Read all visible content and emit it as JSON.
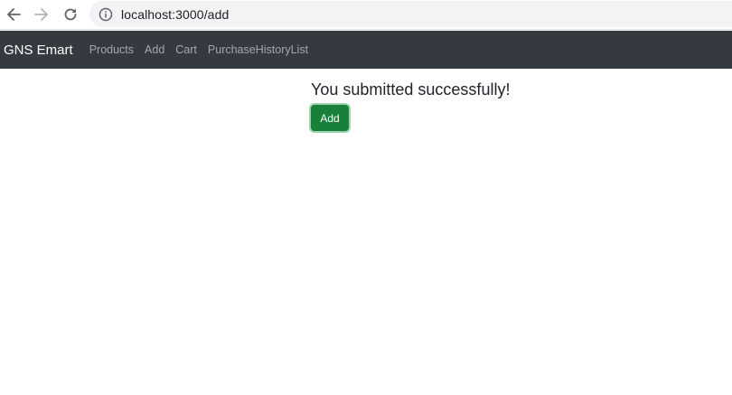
{
  "browser": {
    "url": "localhost:3000/add",
    "icons": {
      "back": "arrow-left-icon",
      "forward": "arrow-right-icon",
      "reload": "reload-icon",
      "info": "info-circle-icon"
    }
  },
  "navbar": {
    "brand": "GNS Emart",
    "links": [
      "Products",
      "Add",
      "Cart",
      "PurchaseHistoryList"
    ]
  },
  "main": {
    "message": "You submitted successfully!",
    "button_label": "Add"
  },
  "colors": {
    "navbar_bg": "#343a40",
    "button_bg": "#198039",
    "button_focus_ring": "#9fd3ae"
  }
}
